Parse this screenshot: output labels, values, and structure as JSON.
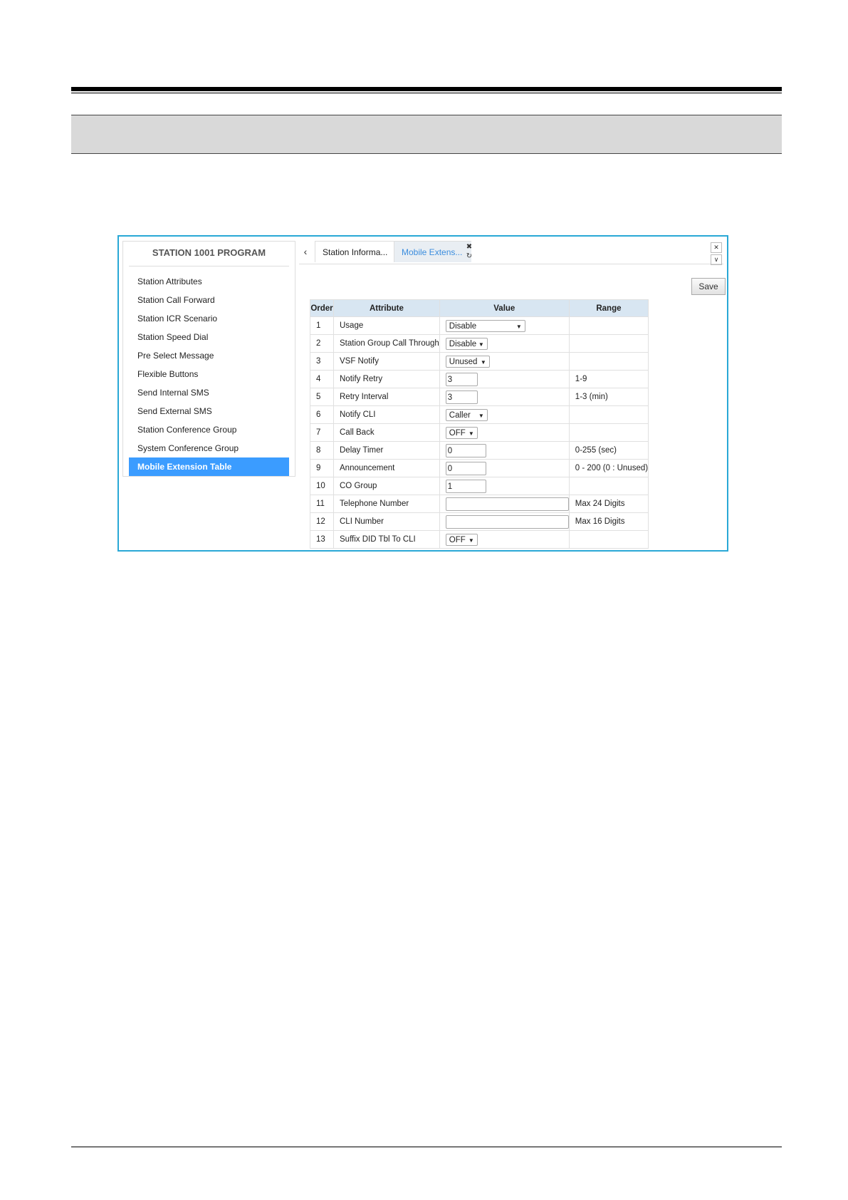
{
  "sidebar": {
    "title": "STATION 1001 PROGRAM",
    "items": [
      {
        "label": "Station Attributes"
      },
      {
        "label": "Station Call Forward"
      },
      {
        "label": "Station ICR Scenario"
      },
      {
        "label": "Station Speed Dial"
      },
      {
        "label": "Pre Select Message"
      },
      {
        "label": "Flexible Buttons"
      },
      {
        "label": "Send Internal SMS"
      },
      {
        "label": "Send External SMS"
      },
      {
        "label": "Station Conference Group"
      },
      {
        "label": "System Conference Group"
      },
      {
        "label": "Mobile Extension Table"
      }
    ],
    "active_item": "Mobile Extension Table"
  },
  "tabs": {
    "prev_icon": "chevron-left-icon",
    "items": [
      {
        "label": "Station Informa..."
      },
      {
        "label": "Mobile Extens..."
      }
    ],
    "active_tab": "Mobile Extens...",
    "accent_color": "#3b8dde"
  },
  "toolbar": {
    "save_label": "Save"
  },
  "table": {
    "headers": {
      "order": "Order",
      "attribute": "Attribute",
      "value": "Value",
      "range": "Range"
    },
    "rows": [
      {
        "order": "1",
        "attribute": "Usage",
        "control": "select",
        "value": "Disable",
        "range": ""
      },
      {
        "order": "2",
        "attribute": "Station Group Call Through",
        "control": "select",
        "value": "Disable",
        "range": ""
      },
      {
        "order": "3",
        "attribute": "VSF Notify",
        "control": "select",
        "value": "Unused",
        "range": ""
      },
      {
        "order": "4",
        "attribute": "Notify Retry",
        "control": "input",
        "value": "3",
        "range": "1-9"
      },
      {
        "order": "5",
        "attribute": "Retry Interval",
        "control": "input",
        "value": "3",
        "range": "1-3 (min)"
      },
      {
        "order": "6",
        "attribute": "Notify CLI",
        "control": "select",
        "value": "Caller",
        "range": ""
      },
      {
        "order": "7",
        "attribute": "Call Back",
        "control": "select",
        "value": "OFF",
        "range": ""
      },
      {
        "order": "8",
        "attribute": "Delay Timer",
        "control": "input",
        "value": "0",
        "range": "0-255 (sec)"
      },
      {
        "order": "9",
        "attribute": "Announcement",
        "control": "input",
        "value": "0",
        "range": "0 - 200 (0 : Unused)"
      },
      {
        "order": "10",
        "attribute": "CO Group",
        "control": "input",
        "value": "1",
        "range": ""
      },
      {
        "order": "11",
        "attribute": "Telephone Number",
        "control": "input",
        "value": "",
        "range": "Max 24 Digits"
      },
      {
        "order": "12",
        "attribute": "CLI Number",
        "control": "input",
        "value": "",
        "range": "Max 16 Digits"
      },
      {
        "order": "13",
        "attribute": "Suffix DID Tbl To CLI",
        "control": "select",
        "value": "OFF",
        "range": ""
      }
    ]
  },
  "colors": {
    "frame_border": "#29a8d6",
    "active_item_bg": "#3b9cff",
    "table_header_bg": "#d8e6f2"
  }
}
